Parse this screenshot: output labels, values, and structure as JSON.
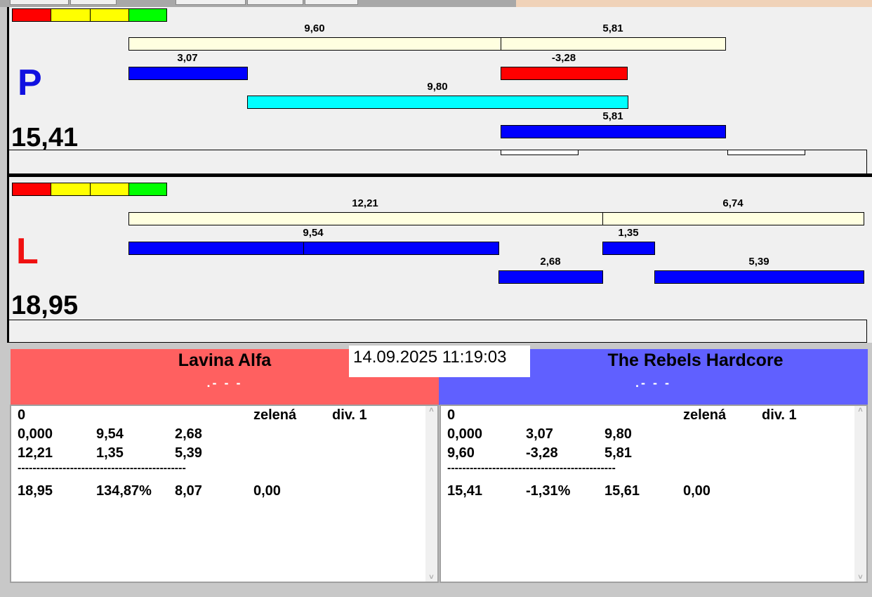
{
  "top": {
    "letter": "P",
    "total": "15,41",
    "bars": [
      "9,60",
      "5,81",
      "3,07",
      "-3,28",
      "9,80",
      "5,81"
    ]
  },
  "bottom": {
    "letter": "L",
    "total": "18,95",
    "bars": [
      "12,21",
      "6,74",
      "9,54",
      "1,35",
      "2,68",
      "5,39"
    ]
  },
  "datetime": "14.09.2025 11:19:03",
  "left_team": {
    "name": "Lavina Alfa",
    "sub": ".- - -",
    "color": "#ff6060",
    "rows": [
      [
        "0",
        "",
        "",
        "zelená",
        "div. 1"
      ],
      [
        "0,000",
        "9,54",
        "2,68"
      ],
      [
        "12,21",
        "1,35",
        "5,39"
      ]
    ],
    "sep": "---------------------------------------------",
    "summary": [
      "18,95",
      "134,87%",
      "8,07",
      "0,00"
    ]
  },
  "right_team": {
    "name": "The Rebels Hardcore",
    "sub": ".- - -",
    "color": "#6060ff",
    "rows": [
      [
        "0",
        "",
        "",
        "zelená",
        "div. 1"
      ],
      [
        "0,000",
        "3,07",
        "9,80"
      ],
      [
        "9,60",
        "-3,28",
        "5,81"
      ]
    ],
    "sep": "---------------------------------------------",
    "summary": [
      "15,41",
      "-1,31%",
      "15,61",
      "0,00"
    ]
  }
}
